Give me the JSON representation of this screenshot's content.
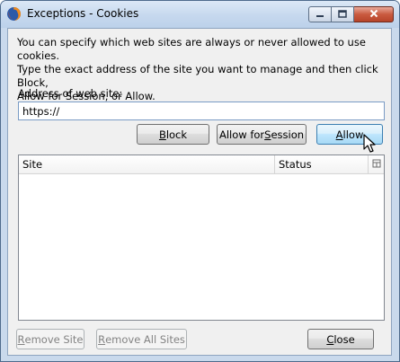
{
  "window": {
    "title": "Exceptions - Cookies"
  },
  "icons": {
    "app": "firefox-icon",
    "minimize": "minimize-icon",
    "maximize": "maximize-icon",
    "close": "close-icon",
    "column_picker": "column-picker-icon",
    "cursor": "mouse-pointer-icon"
  },
  "intro": {
    "text": "You can specify which web sites are always or never allowed to use cookies.\nType the exact address of the site you want to manage and then click Block,\nAllow for Session, or Allow."
  },
  "address": {
    "label": "Address of web site:",
    "value": "https://"
  },
  "actions": {
    "block": {
      "before": "",
      "key": "B",
      "after": "lock"
    },
    "allow_session": {
      "before": "Allow for ",
      "key": "S",
      "after": "ession"
    },
    "allow": {
      "before": "",
      "key": "A",
      "after": "llow"
    }
  },
  "sites_table": {
    "columns": [
      "Site",
      "Status"
    ],
    "rows": []
  },
  "footer": {
    "remove_site": {
      "before": "",
      "key": "R",
      "after": "emove Site"
    },
    "remove_all": {
      "before": "",
      "key": "R",
      "after": "emove All Sites"
    },
    "close": {
      "before": "",
      "key": "C",
      "after": "lose"
    }
  },
  "colors": {
    "titlebar": "#c6d8ee",
    "client_bg": "#f0f0f0",
    "close_button": "#c95a3f",
    "hover_border": "#3c7fb1"
  }
}
